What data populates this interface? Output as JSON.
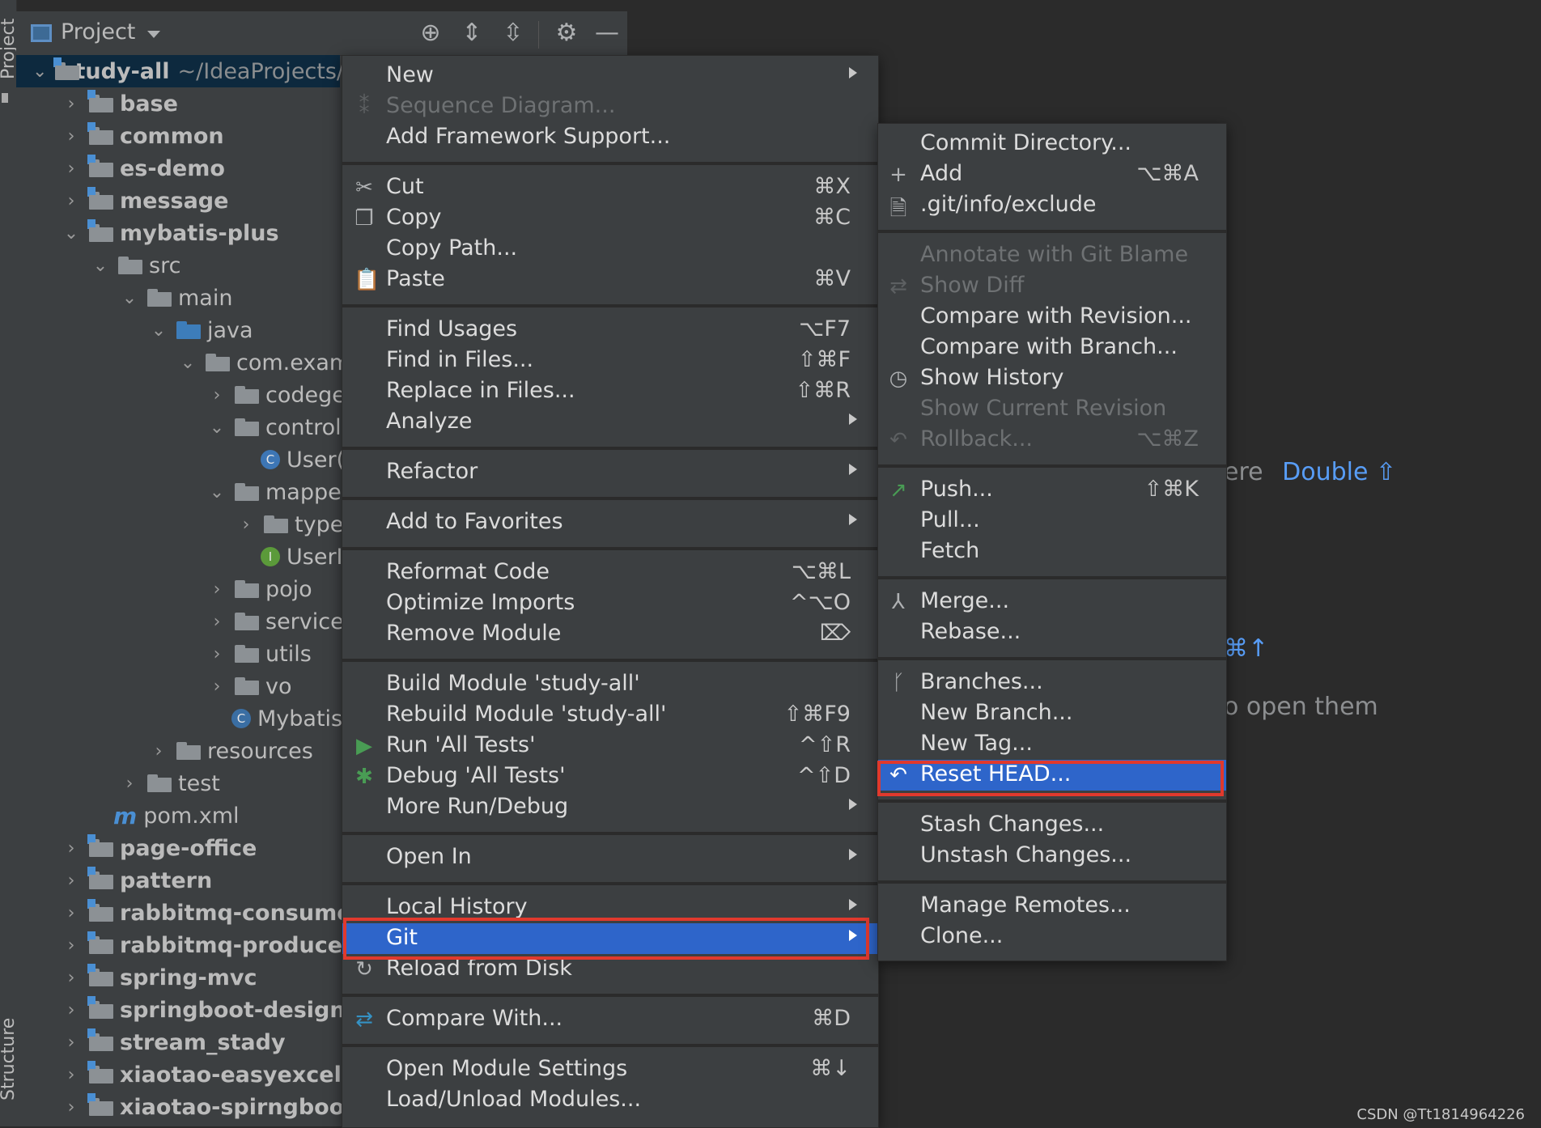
{
  "tool_strip": {
    "project_label": "Project",
    "structure_label": "Structure"
  },
  "project_panel": {
    "title": "Project",
    "tree": [
      {
        "label": "study-all",
        "path": "~/IdeaProjects/"
      },
      {
        "label": "base"
      },
      {
        "label": "common"
      },
      {
        "label": "es-demo"
      },
      {
        "label": "message"
      },
      {
        "label": "mybatis-plus"
      },
      {
        "label": "src"
      },
      {
        "label": "main"
      },
      {
        "label": "java"
      },
      {
        "label": "com.examp"
      },
      {
        "label": "codeger"
      },
      {
        "label": "controlle"
      },
      {
        "label": "User("
      },
      {
        "label": "mapper"
      },
      {
        "label": "type"
      },
      {
        "label": "UserI"
      },
      {
        "label": "pojo"
      },
      {
        "label": "service"
      },
      {
        "label": "utils"
      },
      {
        "label": "vo"
      },
      {
        "label": "Mybatis"
      },
      {
        "label": "resources"
      },
      {
        "label": "test"
      },
      {
        "label": "pom.xml"
      },
      {
        "label": "page-office"
      },
      {
        "label": "pattern"
      },
      {
        "label": "rabbitmq-consumer"
      },
      {
        "label": "rabbitmq-producer"
      },
      {
        "label": "spring-mvc"
      },
      {
        "label": "springboot-design-m"
      },
      {
        "label": "stream_stady"
      },
      {
        "label": "xiaotao-easyexcel"
      },
      {
        "label": "xiaotao-spirngboot"
      }
    ]
  },
  "context_menu": {
    "items": [
      {
        "label": "New"
      },
      {
        "label": "Sequence Diagram..."
      },
      {
        "label": "Add Framework Support..."
      },
      {
        "label": "Cut",
        "shortcut": "⌘X"
      },
      {
        "label": "Copy",
        "shortcut": "⌘C"
      },
      {
        "label": "Copy Path..."
      },
      {
        "label": "Paste",
        "shortcut": "⌘V"
      },
      {
        "label": "Find Usages",
        "shortcut": "⌥F7"
      },
      {
        "label": "Find in Files...",
        "shortcut": "⇧⌘F"
      },
      {
        "label": "Replace in Files...",
        "shortcut": "⇧⌘R"
      },
      {
        "label": "Analyze"
      },
      {
        "label": "Refactor"
      },
      {
        "label": "Add to Favorites"
      },
      {
        "label": "Reformat Code",
        "shortcut": "⌥⌘L"
      },
      {
        "label": "Optimize Imports",
        "shortcut": "^⌥O"
      },
      {
        "label": "Remove Module",
        "shortcut": "⌦"
      },
      {
        "label": "Build Module 'study-all'"
      },
      {
        "label": "Rebuild Module 'study-all'",
        "shortcut": "⇧⌘F9"
      },
      {
        "label": "Run 'All Tests'",
        "shortcut": "^⇧R"
      },
      {
        "label": "Debug 'All Tests'",
        "shortcut": "^⇧D"
      },
      {
        "label": "More Run/Debug"
      },
      {
        "label": "Open In"
      },
      {
        "label": "Local History"
      },
      {
        "label": "Git"
      },
      {
        "label": "Reload from Disk"
      },
      {
        "label": "Compare With...",
        "shortcut": "⌘D"
      },
      {
        "label": "Open Module Settings",
        "shortcut": "⌘↓"
      },
      {
        "label": "Load/Unload Modules..."
      }
    ]
  },
  "git_submenu": {
    "items": [
      {
        "label": "Commit Directory..."
      },
      {
        "label": "Add",
        "shortcut": "⌥⌘A"
      },
      {
        "label": ".git/info/exclude"
      },
      {
        "label": "Annotate with Git Blame"
      },
      {
        "label": "Show Diff"
      },
      {
        "label": "Compare with Revision..."
      },
      {
        "label": "Compare with Branch..."
      },
      {
        "label": "Show History"
      },
      {
        "label": "Show Current Revision"
      },
      {
        "label": "Rollback...",
        "shortcut": "⌥⌘Z"
      },
      {
        "label": "Push...",
        "shortcut": "⇧⌘K"
      },
      {
        "label": "Pull..."
      },
      {
        "label": "Fetch"
      },
      {
        "label": "Merge..."
      },
      {
        "label": "Rebase..."
      },
      {
        "label": "Branches..."
      },
      {
        "label": "New Branch..."
      },
      {
        "label": "New Tag..."
      },
      {
        "label": "Reset HEAD..."
      },
      {
        "label": "Stash Changes..."
      },
      {
        "label": "Unstash Changes..."
      },
      {
        "label": "Manage Remotes..."
      },
      {
        "label": "Clone..."
      }
    ]
  },
  "editor_hints": {
    "hint1_prefix": "ere",
    "hint1_blue": "Double ⇧",
    "hint2": "⌘↑",
    "hint3": "o open them"
  },
  "watermark": "CSDN @Tt1814964226",
  "colors": {
    "selection": "#2e65ca",
    "annotation_box": "#e0392d",
    "menu_bg": "#3c3f41",
    "editor_bg": "#2b2b2b"
  }
}
